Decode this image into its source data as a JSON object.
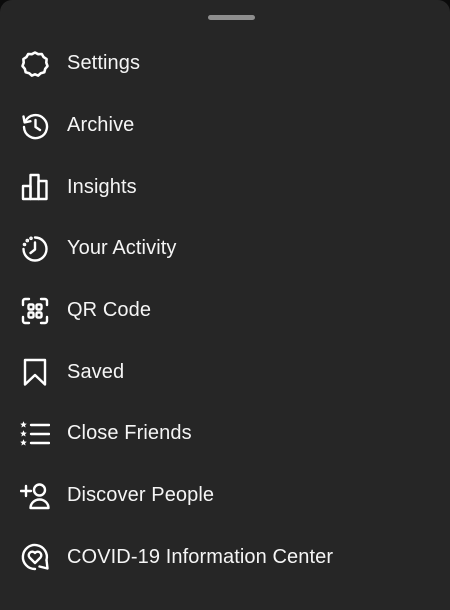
{
  "menu": {
    "items": [
      {
        "label": "Settings",
        "icon": "settings-icon"
      },
      {
        "label": "Archive",
        "icon": "archive-icon"
      },
      {
        "label": "Insights",
        "icon": "insights-icon"
      },
      {
        "label": "Your Activity",
        "icon": "your-activity-icon"
      },
      {
        "label": "QR Code",
        "icon": "qr-code-icon"
      },
      {
        "label": "Saved",
        "icon": "saved-icon"
      },
      {
        "label": "Close Friends",
        "icon": "close-friends-icon"
      },
      {
        "label": "Discover People",
        "icon": "discover-people-icon"
      },
      {
        "label": "COVID-19 Information Center",
        "icon": "covid-info-icon"
      }
    ]
  },
  "colors": {
    "sheet_background": "#262626",
    "text": "#f5f5f5",
    "icon": "#ffffff",
    "handle": "#8e8e8e"
  }
}
